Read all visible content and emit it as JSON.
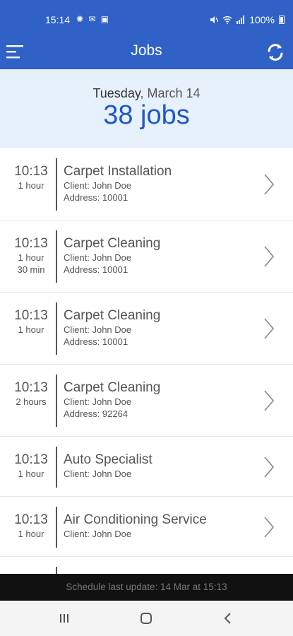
{
  "status_bar": {
    "time": "15:14",
    "left_icons": "✺ ✉ ▣",
    "battery": "100%"
  },
  "app_bar": {
    "title": "Jobs",
    "menu_icon": "menu-icon",
    "refresh_icon": "sync-icon"
  },
  "summary": {
    "weekday": "Tuesday",
    "date": ", March 14",
    "count": "38 jobs"
  },
  "jobs": [
    {
      "time": "10:13",
      "duration": [
        "1 hour"
      ],
      "service": "Carpet Installation",
      "client": "Client: John Doe",
      "address": "Address: 10001"
    },
    {
      "time": "10:13",
      "duration": [
        "1 hour",
        "30 min"
      ],
      "service": "Carpet Cleaning",
      "client": "Client: John Doe",
      "address": "Address: 10001"
    },
    {
      "time": "10:13",
      "duration": [
        "1 hour"
      ],
      "service": "Carpet Cleaning",
      "client": "Client: John Doe",
      "address": "Address: 10001"
    },
    {
      "time": "10:13",
      "duration": [
        "2 hours"
      ],
      "service": "Carpet Cleaning",
      "client": "Client: John Doe",
      "address": "Address: 92264"
    },
    {
      "time": "10:13",
      "duration": [
        "1 hour"
      ],
      "service": "Auto Specialist",
      "client": "Client: John Doe",
      "address": ""
    },
    {
      "time": "10:13",
      "duration": [
        "1 hour"
      ],
      "service": "Air Conditioning Service",
      "client": "Client: John Doe",
      "address": ""
    }
  ],
  "footer": {
    "text": "Schedule last update: 14 Mar at 15:13"
  },
  "colors": {
    "primary": "#2f61c7",
    "count": "#1f57c9",
    "summary_bg": "#e7f1fb"
  }
}
